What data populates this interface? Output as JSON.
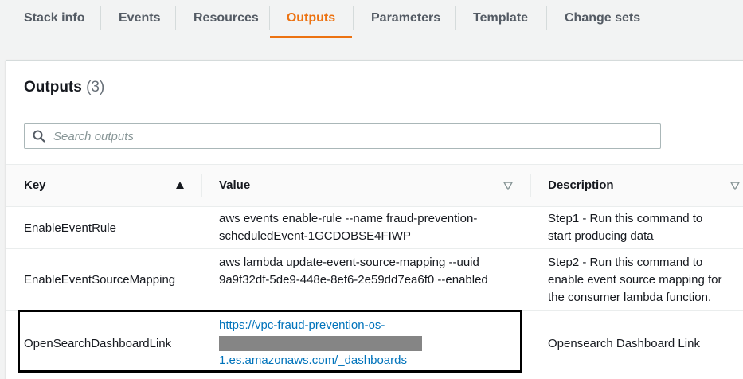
{
  "tabs": [
    {
      "label": "Stack info"
    },
    {
      "label": "Events"
    },
    {
      "label": "Resources"
    },
    {
      "label": "Outputs",
      "active": true
    },
    {
      "label": "Parameters"
    },
    {
      "label": "Template"
    },
    {
      "label": "Change sets"
    }
  ],
  "panel": {
    "title": "Outputs",
    "count": "(3)"
  },
  "search": {
    "placeholder": "Search outputs",
    "value": ""
  },
  "table": {
    "columns": {
      "key": "Key",
      "value": "Value",
      "description": "Description"
    },
    "sort": {
      "column": "Key",
      "direction": "ascending",
      "icon": "triangle-up-icon"
    },
    "rows": [
      {
        "key": "EnableEventRule",
        "value_lines": [
          "aws events enable-rule --name fraud-prevention-",
          "scheduledEvent-1GCDOBSE4FIWP"
        ],
        "description_lines": [
          "Step1 - Run this command to",
          "start producing data"
        ]
      },
      {
        "key": "EnableEventSourceMapping",
        "value_lines": [
          "aws lambda update-event-source-mapping --uuid",
          "9a9f32df-5de9-448e-8ef6-2e59dd7ea6f0 --enabled"
        ],
        "description_lines": [
          "Step2 - Run this command to",
          "enable event source mapping for",
          "the consumer lambda function."
        ]
      },
      {
        "key": "OpenSearchDashboardLink",
        "value_lines": [
          "https://vpc-fraud-prevention-os-",
          "1.es.amazonaws.com/_dashboards"
        ],
        "description_lines": [
          "Opensearch Dashboard Link"
        ]
      }
    ]
  },
  "colors": {
    "accent": "#ec7211",
    "link": "#0073bb",
    "text": "#16191f",
    "muted": "#545b64"
  }
}
